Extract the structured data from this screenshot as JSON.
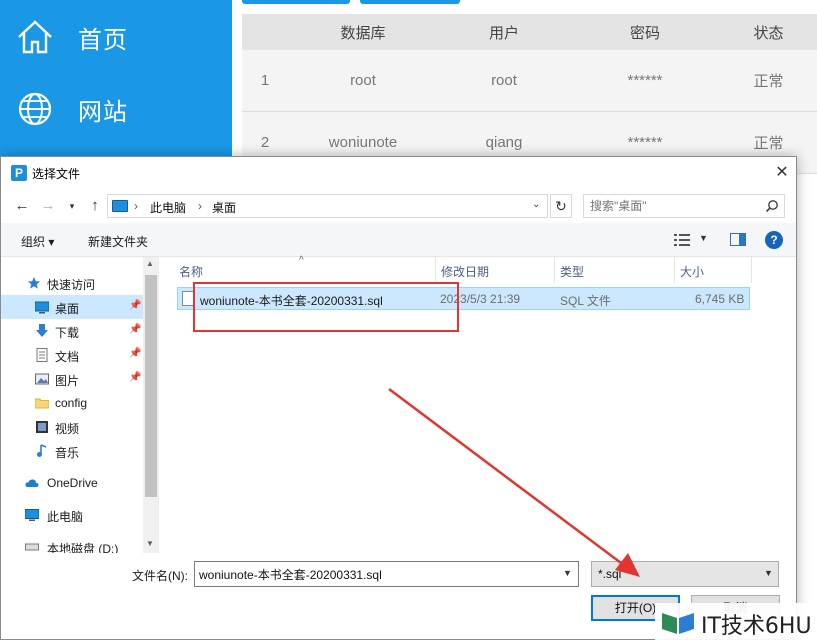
{
  "sidebar": {
    "items": [
      {
        "label": "首页",
        "icon": "home-icon"
      },
      {
        "label": "网站",
        "icon": "globe-icon"
      }
    ]
  },
  "db_table": {
    "columns": [
      "",
      "数据库",
      "用户",
      "密码",
      "状态"
    ],
    "rows": [
      [
        "1",
        "root",
        "root",
        "******",
        "正常"
      ],
      [
        "2",
        "woniunote",
        "qiang",
        "******",
        "正常"
      ]
    ]
  },
  "dialog": {
    "title": "选择文件",
    "app_icon_letter": "P",
    "close_glyph": "✕",
    "breadcrumb": [
      "此电脑",
      "桌面"
    ],
    "search_placeholder": "搜索\"桌面\"",
    "toolbar": {
      "organize": "组织 ▾",
      "new_folder": "新建文件夹"
    },
    "nav_items": [
      {
        "label": "快速访问",
        "icon": "star-icon"
      },
      {
        "label": "桌面",
        "icon": "desktop-icon",
        "selected": true
      },
      {
        "label": "下载",
        "icon": "download-icon"
      },
      {
        "label": "文档",
        "icon": "document-icon"
      },
      {
        "label": "图片",
        "icon": "picture-icon"
      },
      {
        "label": "config",
        "icon": "folder-icon"
      },
      {
        "label": "视频",
        "icon": "video-icon"
      },
      {
        "label": "音乐",
        "icon": "music-icon"
      },
      {
        "label": "OneDrive",
        "icon": "cloud-icon"
      },
      {
        "label": "此电脑",
        "icon": "computer-icon"
      },
      {
        "label": "本地磁盘 (D:)",
        "icon": "drive-icon"
      }
    ],
    "list_columns": {
      "name": "名称",
      "modified": "修改日期",
      "type": "类型",
      "size": "大小"
    },
    "files": [
      {
        "name": "woniunote-本书全套-20200331.sql",
        "modified": "2023/5/3 21:39",
        "type": "SQL 文件",
        "size": "6,745 KB"
      }
    ],
    "filename_label": "文件名(N):",
    "filename_value": "woniunote-本书全套-20200331.sql",
    "filetype_value": "*.sql",
    "open_label": "打开(O)",
    "cancel_label": "取消"
  },
  "annotation": {
    "color": "#e1352f"
  },
  "watermark": {
    "text": "IT技术6HU"
  },
  "colors": {
    "sidebar": "#1a98e6",
    "selection": "#cce8ff",
    "accent": "#0078d7"
  }
}
